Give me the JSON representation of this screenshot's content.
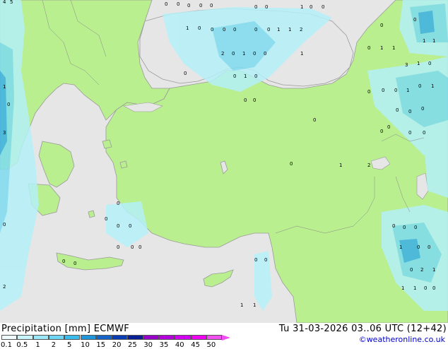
{
  "map": {
    "colors": {
      "sea": "#e6e6e6",
      "land": "#b9ef8f",
      "border": "#999999",
      "precip_light": "#b4f0f8",
      "precip_mid": "#7fdcf0",
      "precip_heavy": "#3cb0e6"
    },
    "grid_values": [
      "0",
      "0",
      "0",
      "0",
      "0",
      "0",
      "0",
      "1",
      "0",
      "0",
      "1",
      "0",
      "0",
      "0",
      "0",
      "0",
      "0",
      "1",
      "1",
      "2",
      "2",
      "0",
      "1",
      "0",
      "0",
      "1",
      "0",
      "0",
      "1",
      "0",
      "0",
      "0",
      "0",
      "1",
      "1",
      "0",
      "0",
      "1",
      "1",
      "3",
      "1",
      "0",
      "0",
      "0",
      "0",
      "1",
      "0",
      "1",
      "0",
      "0",
      "0",
      "0",
      "0",
      "0",
      "0",
      "2",
      "1",
      "0",
      "0",
      "0",
      "0",
      "1",
      "1",
      "0",
      "0",
      "0",
      "0",
      "0",
      "0",
      "0",
      "0",
      "0",
      "4",
      "5",
      "1",
      "0",
      "3",
      "0",
      "2",
      "0",
      "0",
      "0",
      "1",
      "0",
      "0",
      "0",
      "2",
      "1",
      "1",
      "1",
      "0",
      "0",
      "0"
    ]
  },
  "legend": {
    "title": "Precipitation [mm]  ECMWF",
    "datetime": "Tu 31-03-2026 03..06 UTC (12+42)",
    "credit": "©weatheronline.co.uk",
    "scale_labels": [
      "0.1",
      "0.5",
      "1",
      "2",
      "5",
      "10",
      "15",
      "20",
      "25",
      "30",
      "35",
      "40",
      "45",
      "50"
    ],
    "scale_colors": [
      "#f0fcff",
      "#c8f4fc",
      "#9ae8f8",
      "#6cd6f4",
      "#3cbcec",
      "#1e96dc",
      "#1464c8",
      "#0a3cb4",
      "#0a1e96",
      "#9600c8",
      "#b400dc",
      "#d200f0",
      "#f000f0",
      "#f050f0"
    ]
  }
}
